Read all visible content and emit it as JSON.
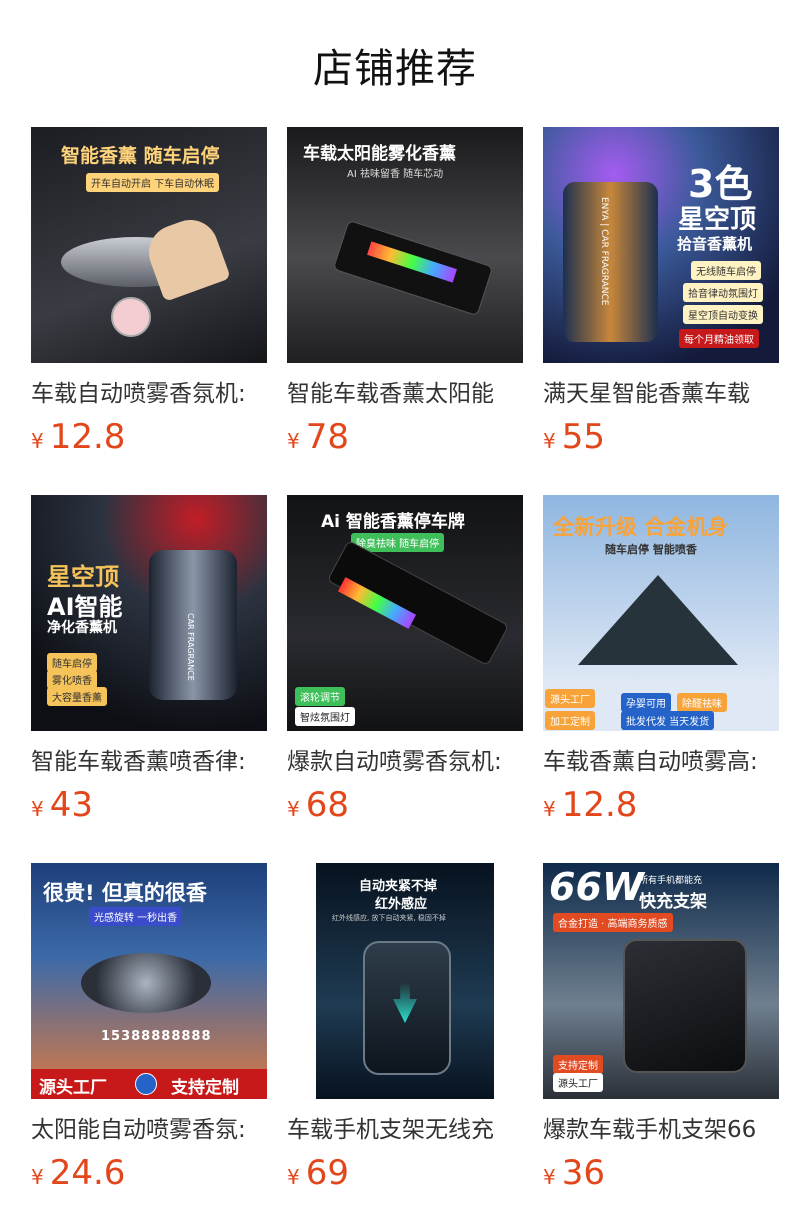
{
  "page": {
    "title": "店铺推荐"
  },
  "currency": "¥",
  "products": [
    {
      "name": "车载自动喷雾香氛机:",
      "price": "12.8",
      "image": {
        "headline": "智能香薰 随车启停",
        "sub": "开车自动开启 下车自动休眠",
        "colors": {
          "bg1": "#1b1d22",
          "bg2": "#3a3c43",
          "accent": "#ffd37a"
        }
      }
    },
    {
      "name": "智能车载香薰太阳能",
      "price": "78",
      "image": {
        "headline": "车载太阳能雾化香薰",
        "sub": "AI 祛味留香  随车芯动",
        "colors": {
          "bg1": "#1a1a1c",
          "bg2": "#4a4a4e",
          "accent": "#ffffff"
        }
      }
    },
    {
      "name": "满天星智能香薰车载",
      "price": "55",
      "image": {
        "headline": "3色",
        "headline2": "星空顶",
        "sub": "拾音香薰机",
        "badges": [
          "无线随车启停",
          "拾音律动氛围灯",
          "星空顶自动变换"
        ],
        "promo": "每个月精油领取",
        "vertical_text": "ENYA | CAR FRAGRANCE",
        "colors": {
          "bg1": "#141a3a",
          "bg2": "#3b5a9a",
          "accent": "#ffffff"
        }
      }
    },
    {
      "name": "智能车载香薰喷香律:",
      "price": "43",
      "image": {
        "headline": "星空顶",
        "headline2": "AI智能",
        "sub": "净化香薰机",
        "badges": [
          "随车启停",
          "雾化喷香",
          "大容量香薰"
        ],
        "vertical_text": "CAR FRAGRANCE",
        "colors": {
          "bg1": "#0d0f14",
          "bg2": "#2c3340",
          "accent": "#f5c35a"
        }
      }
    },
    {
      "name": "爆款自动喷雾香氛机:",
      "price": "68",
      "image": {
        "headline": "Ai 智能香薰停车牌",
        "sub": "除臭祛味  随车启停",
        "badges": [
          "滚轮调节",
          "智炫氛围灯"
        ],
        "colors": {
          "bg1": "#111214",
          "bg2": "#2a2b30",
          "accent": "#3fbf5a"
        }
      }
    },
    {
      "name": "车载香薰自动喷雾高:",
      "price": "12.8",
      "image": {
        "headline": "全新升级  合金机身",
        "sub": "随车启停  智能喷香",
        "badges": [
          "源头工厂",
          "孕婴可用",
          "除醛祛味",
          "加工定制",
          "批发代发  当天发货"
        ],
        "colors": {
          "bg1": "#8fb6e0",
          "bg2": "#dfe8f5",
          "accent": "#f7a33a"
        }
      }
    },
    {
      "name": "太阳能自动喷雾香氛:",
      "price": "24.6",
      "image": {
        "headline": "很贵! 但真的很香",
        "sub": "光感旋转  一秒出香",
        "plate": "15388888888",
        "banner_left": "源头工厂",
        "banner_right": "支持定制",
        "colors": {
          "bg1": "#1d3f7a",
          "bg2": "#e07a3e",
          "accent": "#c8191a"
        }
      }
    },
    {
      "name": "车载手机支架无线充",
      "price": "69",
      "image": {
        "headline": "自动夹紧不掉",
        "headline2": "红外感应",
        "sub": "红外线感应, 放下自动夹紧, 稳固不掉",
        "colors": {
          "bg1": "#07121f",
          "bg2": "#1f3b52",
          "accent": "#2fe3d0"
        }
      }
    },
    {
      "name": "爆款车载手机支架66",
      "price": "36",
      "image": {
        "headline": "66W",
        "headline_small": "所有手机都能充",
        "headline2": "快充支架",
        "sub": "合金打造 · 高端商务质感",
        "badges": [
          "支持定制",
          "源头工厂"
        ],
        "colors": {
          "bg1": "#0e2a4a",
          "bg2": "#6f7f8f",
          "accent": "#e24a22"
        }
      }
    }
  ]
}
